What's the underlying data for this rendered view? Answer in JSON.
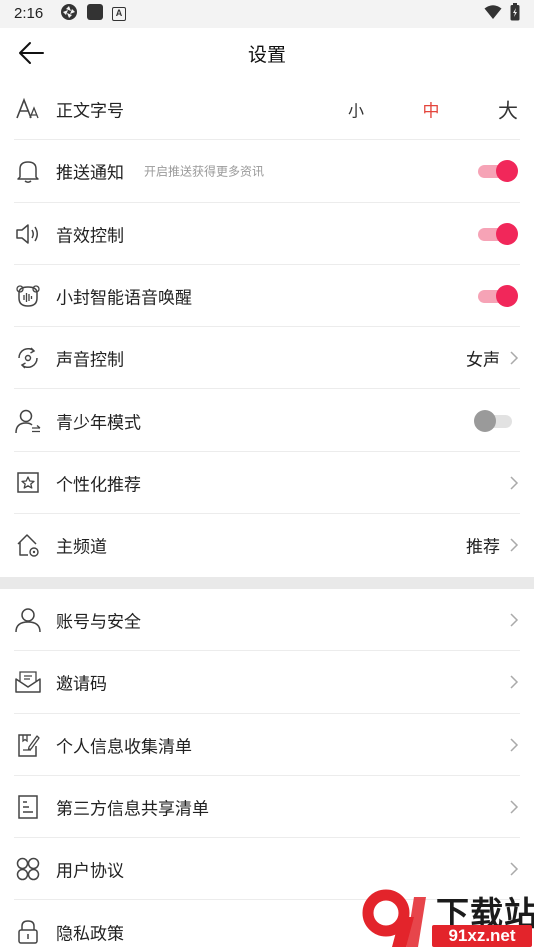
{
  "status_bar": {
    "time": "2:16",
    "app_badge": "A"
  },
  "header": {
    "title": "设置"
  },
  "font_size": {
    "label": "正文字号",
    "options": [
      "小",
      "中",
      "大"
    ],
    "selected": "中"
  },
  "settings_group_1": [
    {
      "label": "推送通知",
      "hint": "开启推送获得更多资讯",
      "toggle": true
    },
    {
      "label": "音效控制",
      "toggle": true
    },
    {
      "label": "小封智能语音唤醒",
      "toggle": true
    },
    {
      "label": "声音控制",
      "value": "女声"
    },
    {
      "label": "青少年模式",
      "toggle": false
    },
    {
      "label": "个性化推荐"
    },
    {
      "label": "主频道",
      "value": "推荐"
    }
  ],
  "settings_group_2": [
    {
      "label": "账号与安全"
    },
    {
      "label": "邀请码"
    },
    {
      "label": "个人信息收集清单"
    },
    {
      "label": "第三方信息共享清单"
    },
    {
      "label": "用户协议"
    },
    {
      "label": "隐私政策"
    }
  ],
  "watermark": {
    "text": "下载站",
    "url": "91xz.net"
  },
  "colors": {
    "accent": "#f1275a",
    "selected_size": "#e4453c",
    "toggle_track_on": "#f6a3b6",
    "watermark_red": "#e3242b"
  }
}
